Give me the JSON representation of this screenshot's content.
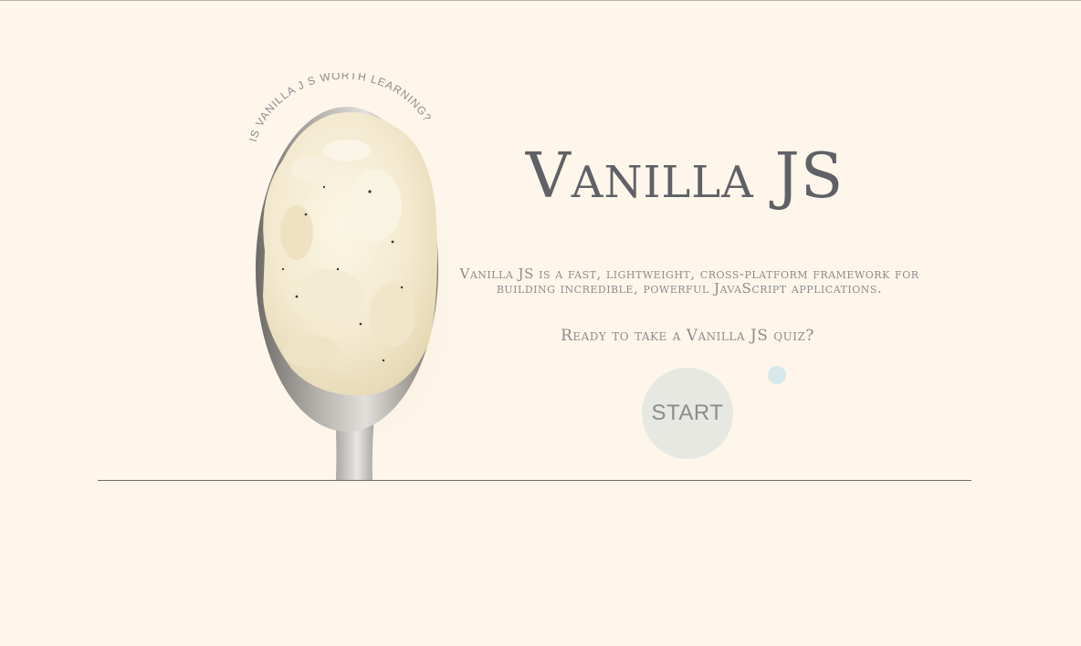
{
  "hero": {
    "curved_caption": "IS VANILLA J S WORTH LEARNING?",
    "title": "Vanilla JS",
    "description_line1": "Vanilla JS is a fast, lightweight, cross-platform framework for",
    "description_line2": "building incredible, powerful JavaScript applications.",
    "prompt": "Ready to take a Vanilla JS quiz?",
    "start_label": "START"
  },
  "colors": {
    "background": "#fef6ea",
    "text_primary": "#5f6166",
    "text_secondary": "#8b8c8f",
    "button_bg": "#e6e8e1",
    "accent_dot": "#d6e8e9"
  },
  "images": {
    "spoon": "vanilla-ice-cream-spoon"
  }
}
